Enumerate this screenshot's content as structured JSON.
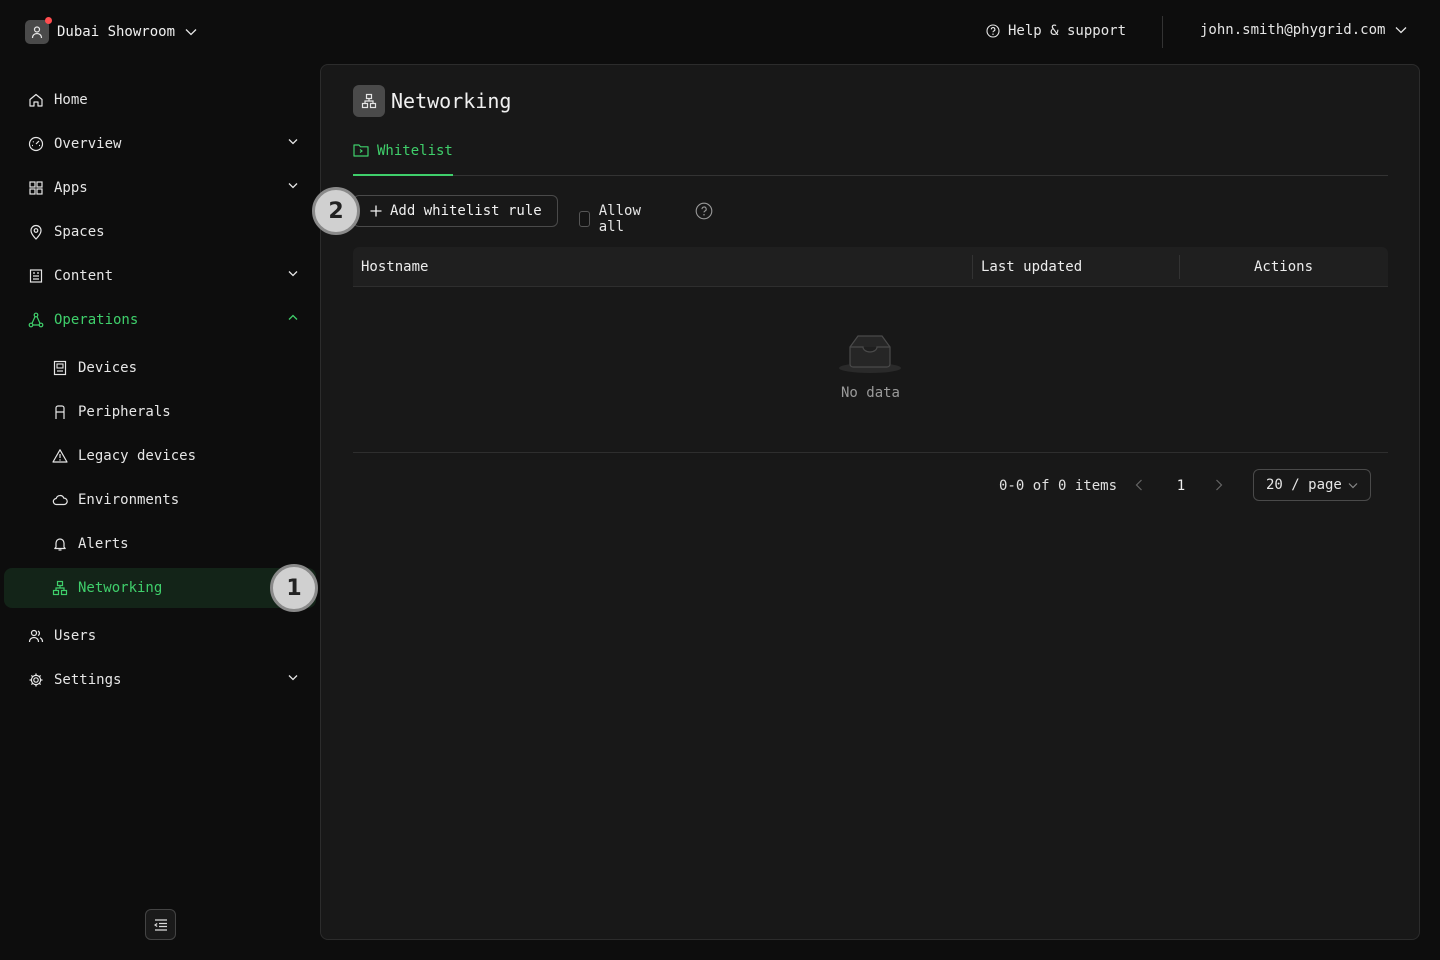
{
  "header": {
    "org_name": "Dubai Showroom",
    "help_label": "Help & support",
    "user_email": "john.smith@phygrid.com"
  },
  "sidebar": {
    "items": [
      {
        "label": "Home",
        "icon": "home-icon"
      },
      {
        "label": "Overview",
        "icon": "dashboard-icon",
        "expandable": true
      },
      {
        "label": "Apps",
        "icon": "apps-grid-icon",
        "expandable": true
      },
      {
        "label": "Spaces",
        "icon": "location-pin-icon"
      },
      {
        "label": "Content",
        "icon": "content-icon",
        "expandable": true
      },
      {
        "label": "Operations",
        "icon": "operations-icon",
        "expanded": true
      },
      {
        "label": "Devices",
        "icon": "device-icon"
      },
      {
        "label": "Peripherals",
        "icon": "peripheral-icon"
      },
      {
        "label": "Legacy devices",
        "icon": "warning-icon"
      },
      {
        "label": "Environments",
        "icon": "cloud-icon"
      },
      {
        "label": "Alerts",
        "icon": "bell-icon"
      },
      {
        "label": "Networking",
        "icon": "network-icon",
        "active": true
      },
      {
        "label": "Users",
        "icon": "users-icon"
      },
      {
        "label": "Settings",
        "icon": "gear-icon",
        "expandable": true
      }
    ]
  },
  "markers": {
    "step1": "1",
    "step2": "2"
  },
  "main": {
    "title": "Networking",
    "tabs": [
      {
        "label": "Whitelist",
        "active": true
      }
    ],
    "add_button_label": "Add whitelist rule",
    "allow_all_label": "Allow all",
    "allow_all_checked": false,
    "table": {
      "columns": [
        "Hostname",
        "Last updated",
        "Actions"
      ],
      "rows": [],
      "empty_text": "No data"
    },
    "pagination": {
      "summary": "0-0 of 0 items",
      "current_page": "1",
      "page_size": "20 / page"
    }
  },
  "colors": {
    "accent": "#3fcf6b",
    "active_bg": "#132418",
    "background": "#0d0d0d",
    "panel": "#181818",
    "notification_dot": "#ff4d4f"
  }
}
